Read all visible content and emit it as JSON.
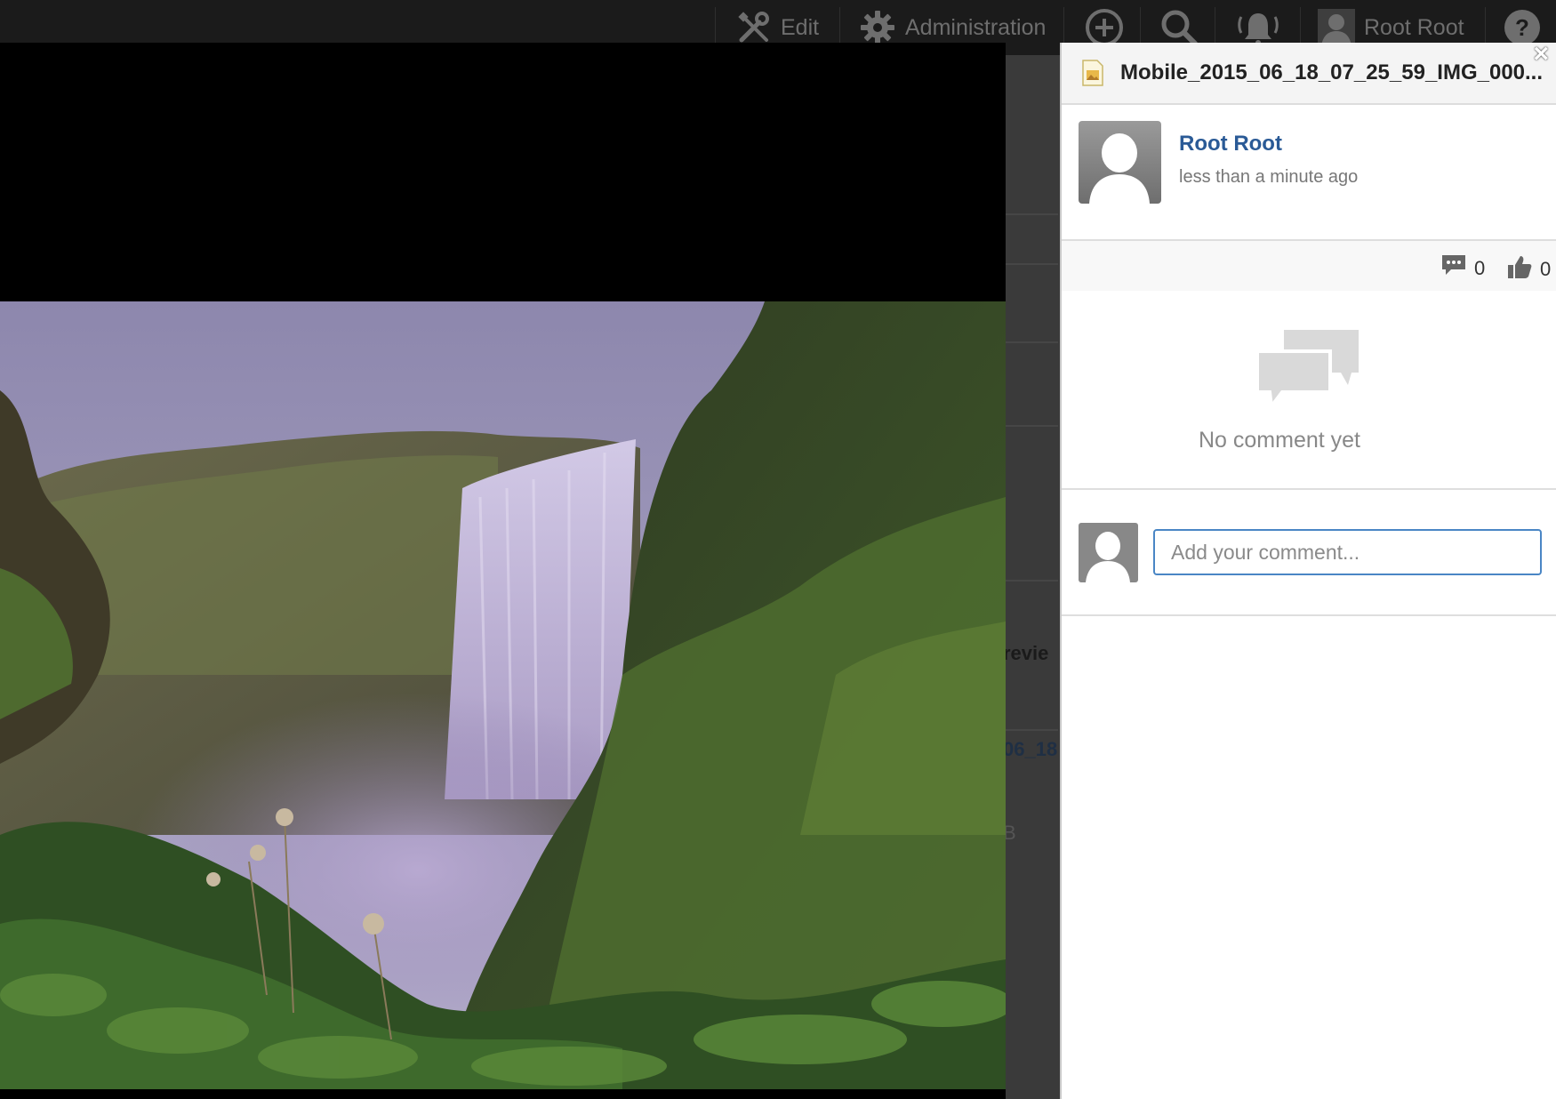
{
  "toolbar": {
    "edit_label": "Edit",
    "admin_label": "Administration",
    "user_name": "Root Root",
    "icons": [
      "edit-icon",
      "gear-icon",
      "add-icon",
      "search-icon",
      "notification-icon",
      "user-avatar",
      "help-icon"
    ]
  },
  "background_page": {
    "partial_preview_text": "revie",
    "partial_link_text": "06_18",
    "partial_size_text": "B"
  },
  "panel": {
    "title": "Mobile_2015_06_18_07_25_59_IMG_000...",
    "close_label": "×",
    "author": {
      "name": "Root Root",
      "time": "less than a minute ago"
    },
    "stats": {
      "comments_count": "0",
      "likes_count": "0"
    },
    "empty_message": "No comment yet",
    "comment_input": {
      "placeholder": "Add your comment...",
      "value": ""
    }
  },
  "colors": {
    "topbar_bg": "#1b1b1b",
    "link": "#2a5a96",
    "input_border": "#4a86c5",
    "viewer_bg": "#000000"
  }
}
